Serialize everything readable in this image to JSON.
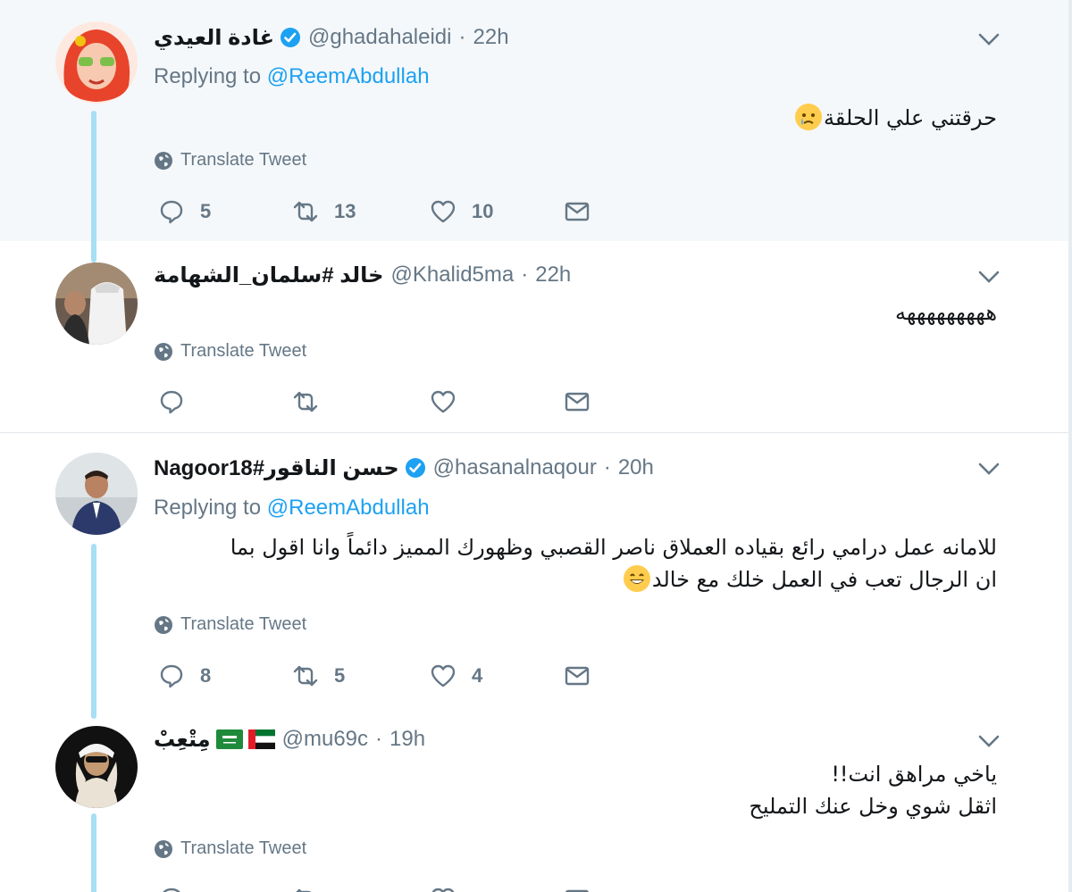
{
  "common": {
    "translate_label": "Translate Tweet",
    "replying_prefix": "Replying to",
    "dot": "·"
  },
  "tweets": [
    {
      "name": "غادة العيدي",
      "handle": "@ghadahaleidi",
      "time": "22h",
      "verified": true,
      "replying_to": "@ReemAbdullah",
      "text_lines": [
        "حرقتني علي الحلقة"
      ],
      "emoji": "crying-face",
      "replies": "5",
      "retweets": "13",
      "likes": "10"
    },
    {
      "name": "خالد #سلمان_الشهامة",
      "handle": "@Khalid5ma",
      "time": "22h",
      "verified": false,
      "text_lines": [
        "هههههههههه"
      ],
      "replies": "",
      "retweets": "",
      "likes": ""
    },
    {
      "name": "Nagoor18#حسن الناقور",
      "handle": "@hasanalnaqour",
      "time": "20h",
      "verified": true,
      "replying_to": "@ReemAbdullah",
      "text_lines": [
        "للامانه عمل درامي رائع بقياده العملاق ناصر القصبي وظهورك المميز دائماً وانا اقول بما",
        "ان الرجال تعب في العمل خلك مع خالد"
      ],
      "emoji": "grinning-face",
      "replies": "8",
      "retweets": "5",
      "likes": "4"
    },
    {
      "name": "مِتْعِبْ",
      "handle": "@mu69c",
      "time": "19h",
      "verified": false,
      "flags": [
        "saudi-flag-icon",
        "uae-flag-icon"
      ],
      "text_lines": [
        "ياخي مراهق انت!!",
        "اثقل شوي وخل عنك التمليح"
      ],
      "replies": "",
      "retweets": "",
      "likes": ""
    }
  ],
  "colors": {
    "highlight_bg": "#f5f8fa",
    "link": "#1da1f2",
    "muted": "#657786",
    "thread_line": "#a7dff5",
    "verified": "#1da1f2"
  }
}
